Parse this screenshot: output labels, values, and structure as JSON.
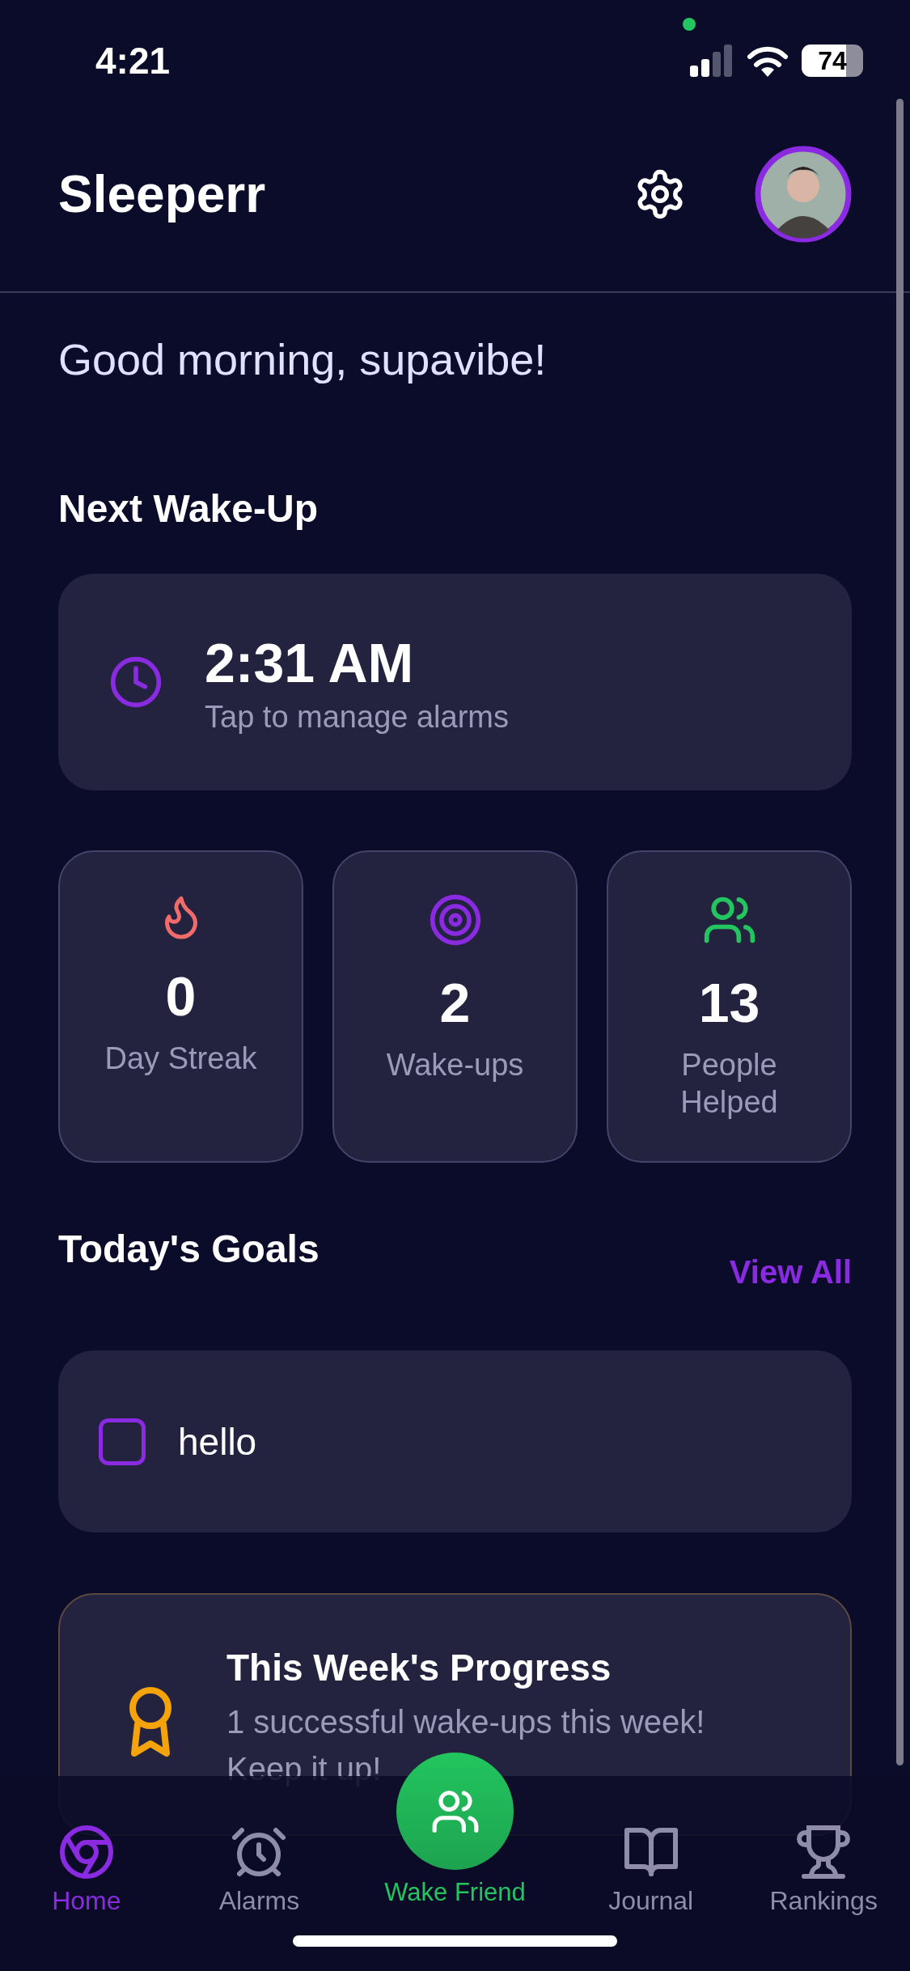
{
  "status_bar": {
    "time": "4:21",
    "battery": "74"
  },
  "header": {
    "title": "Sleeperr"
  },
  "greeting": "Good morning, supavibe!",
  "next_wake_up": {
    "heading": "Next Wake-Up",
    "time": "2:31 AM",
    "subtitle": "Tap to manage alarms"
  },
  "stats": [
    {
      "kind": "flame",
      "value": "0",
      "label": "Day Streak",
      "color": "#f26b6b"
    },
    {
      "kind": "target",
      "value": "2",
      "label": "Wake-ups",
      "color": "#8a2be2"
    },
    {
      "kind": "people",
      "value": "13",
      "label": "People Helped",
      "color": "#22c55e"
    }
  ],
  "goals": {
    "heading": "Today's Goals",
    "view_all": "View All",
    "items": [
      {
        "text": "hello",
        "checked": false
      }
    ]
  },
  "progress": {
    "title": "This Week's Progress",
    "text": "1 successful wake-ups this week! Keep it up!"
  },
  "tab_bar": [
    {
      "kind": "home",
      "label": "Home",
      "selected": true
    },
    {
      "kind": "alarm",
      "label": "Alarms",
      "selected": false
    },
    {
      "kind": "center",
      "label": "Wake Friend",
      "selected": false
    },
    {
      "kind": "journal",
      "label": "Journal",
      "selected": false
    },
    {
      "kind": "rankings",
      "label": "Rankings",
      "selected": false
    }
  ]
}
